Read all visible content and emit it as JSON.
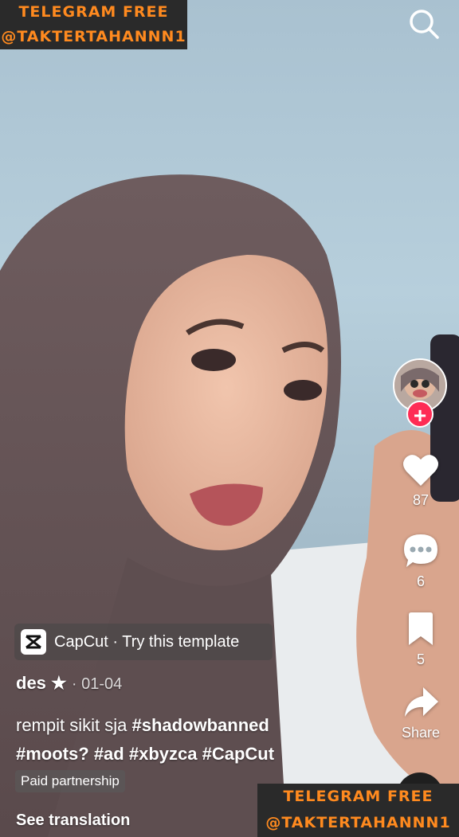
{
  "watermark_top": {
    "line1": "TELEGRAM FREE",
    "line2": "@TAKTERTAHANNN1"
  },
  "watermark_bottom": {
    "line1": "TELEGRAM FREE",
    "line2": "@TAKTERTAHANNN1"
  },
  "search": {
    "icon": "search-icon"
  },
  "rail": {
    "like_count": "87",
    "comment_count": "6",
    "save_count": "5",
    "share_label": "Share",
    "follow_symbol": "+"
  },
  "capcut": {
    "label": "CapCut · Try this template"
  },
  "post": {
    "author": "des",
    "author_badge": "★",
    "separator": " · ",
    "date": "01-04",
    "caption_text": "rempit sikit sja ",
    "hashtags": [
      "#shadowbanned",
      "#moots?",
      "#ad",
      "#xbyzca",
      "#CapCut"
    ],
    "paid_label": "Paid partnership",
    "translate_label": "See translation"
  },
  "colors": {
    "accent": "#fe2c55",
    "watermark_text": "#ff8a1f",
    "watermark_bg": "#2a2a2a"
  }
}
